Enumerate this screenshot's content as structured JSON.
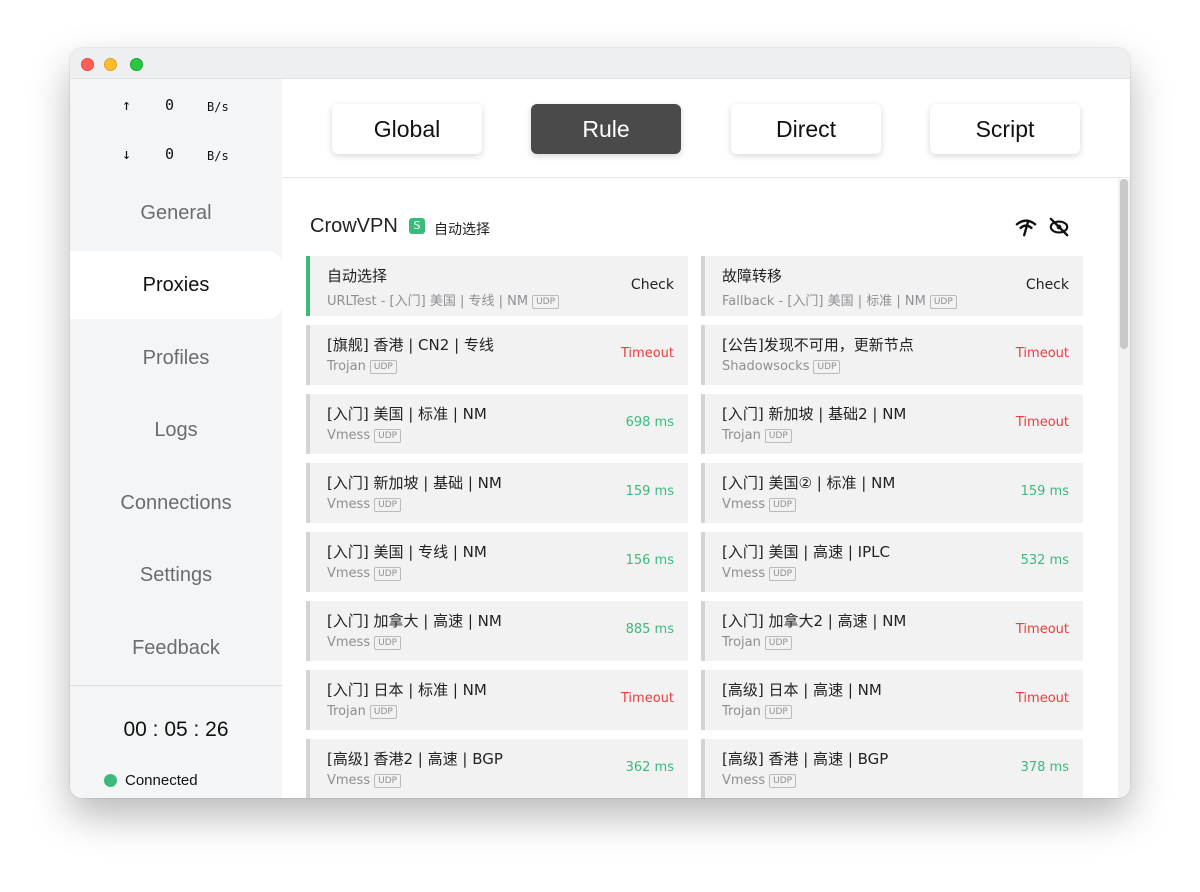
{
  "traffic": {
    "up_arrow": "↑",
    "up_value": "0",
    "up_unit": "B/s",
    "down_arrow": "↓",
    "down_value": "0",
    "down_unit": "B/s"
  },
  "nav": [
    {
      "label": "General"
    },
    {
      "label": "Proxies"
    },
    {
      "label": "Profiles"
    },
    {
      "label": "Logs"
    },
    {
      "label": "Connections"
    },
    {
      "label": "Settings"
    },
    {
      "label": "Feedback"
    }
  ],
  "footer": {
    "timer": "00 : 05 : 26",
    "status": "Connected"
  },
  "modes": [
    {
      "label": "Global"
    },
    {
      "label": "Rule"
    },
    {
      "label": "Direct"
    },
    {
      "label": "Script"
    }
  ],
  "group": {
    "name": "CrowVPN",
    "badge": "S",
    "selected": "自动选择",
    "icons": [
      "speed-test-icon",
      "hide-icon"
    ]
  },
  "proxies": [
    {
      "name": "自动选择",
      "type": "URLTest - [入门] 美国 | 专线 | NM",
      "udp": "UDP",
      "delay": "Check"
    },
    {
      "name": "故障转移",
      "type": "Fallback - [入门] 美国 | 标准 | NM",
      "udp": "UDP",
      "delay": "Check"
    },
    {
      "name": "[旗舰] 香港 | CN2 | 专线",
      "type": "Trojan",
      "udp": "UDP",
      "delay": "Timeout"
    },
    {
      "name": "[公告]发现不可用，更新节点",
      "type": "Shadowsocks",
      "udp": "UDP",
      "delay": "Timeout"
    },
    {
      "name": "[入门] 美国 | 标准 | NM",
      "type": "Vmess",
      "udp": "UDP",
      "delay": "698 ms"
    },
    {
      "name": "[入门] 新加坡 | 基础2 | NM",
      "type": "Trojan",
      "udp": "UDP",
      "delay": "Timeout"
    },
    {
      "name": "[入门] 新加坡 | 基础 | NM",
      "type": "Vmess",
      "udp": "UDP",
      "delay": "159 ms"
    },
    {
      "name": "[入门] 美国② | 标准 | NM",
      "type": "Vmess",
      "udp": "UDP",
      "delay": "159 ms"
    },
    {
      "name": "[入门] 美国 | 专线 | NM",
      "type": "Vmess",
      "udp": "UDP",
      "delay": "156 ms"
    },
    {
      "name": "[入门] 美国 | 高速 | IPLC",
      "type": "Vmess",
      "udp": "UDP",
      "delay": "532 ms"
    },
    {
      "name": "[入门] 加拿大 | 高速 | NM",
      "type": "Vmess",
      "udp": "UDP",
      "delay": "885 ms"
    },
    {
      "name": "[入门] 加拿大2 | 高速 | NM",
      "type": "Trojan",
      "udp": "UDP",
      "delay": "Timeout"
    },
    {
      "name": "[入门] 日本 | 标准 | NM",
      "type": "Trojan",
      "udp": "UDP",
      "delay": "Timeout"
    },
    {
      "name": "[高级] 日本 | 高速 | NM",
      "type": "Trojan",
      "udp": "UDP",
      "delay": "Timeout"
    },
    {
      "name": "[高级] 香港2 | 高速 | BGP",
      "type": "Vmess",
      "udp": "UDP",
      "delay": "362 ms"
    },
    {
      "name": "[高级] 香港 | 高速 | BGP",
      "type": "Vmess",
      "udp": "UDP",
      "delay": "378 ms"
    }
  ],
  "colors": {
    "accent": "#3cba7d",
    "timeout": "#ef3c3c",
    "active_mode": "#4a4a4a"
  }
}
